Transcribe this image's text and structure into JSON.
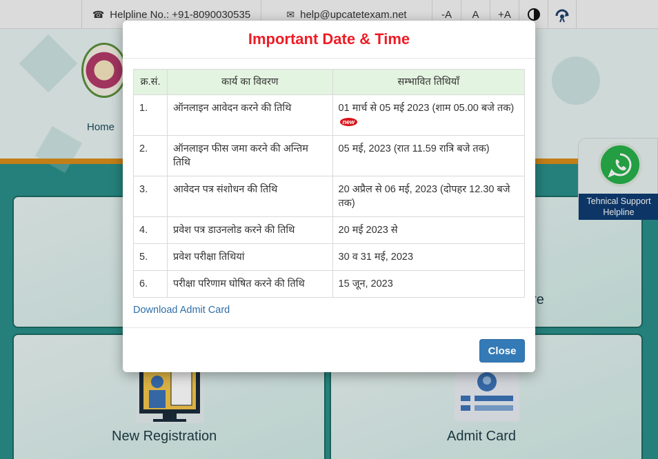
{
  "topbar": {
    "helpline": "Helpline No.: +91-8090030535",
    "email": "help@upcatetexam.net",
    "font_small": "-A",
    "font_normal": "A",
    "font_large": "+A"
  },
  "nav": {
    "home": "Home"
  },
  "cards": {
    "new_registration": "New Registration",
    "admit_card": "Admit Card",
    "partial_right_text": "ure"
  },
  "whatsapp": {
    "label_line1": "Tehnical Support",
    "label_line2": "Helpline"
  },
  "modal": {
    "title": "Important Date & Time",
    "table": {
      "headers": [
        "क्र.सं.",
        "कार्य का विवरण",
        "सम्भावित तिथियाँ"
      ],
      "rows": [
        {
          "sn": "1.",
          "desc": "ऑनलाइन आवेदन करने की तिथि",
          "date": "01 मार्च से 05 मई 2023 (शाम 05.00 बजे तक)",
          "badge": "new"
        },
        {
          "sn": "2.",
          "desc": "ऑनलाइन फीस जमा करने की अन्तिम तिथि",
          "date": "05 मई, 2023 (रात 11.59 रात्रि बजे तक)"
        },
        {
          "sn": "3.",
          "desc": "आवेदन पत्र संशोधन की तिथि",
          "date": "20 अप्रैल से 06 मई, 2023 (दोपहर 12.30 बजे तक)"
        },
        {
          "sn": "4.",
          "desc": "प्रवेश पत्र डाउनलोड करने की तिथि",
          "date": "20 मई 2023 से"
        },
        {
          "sn": "5.",
          "desc": "प्रवेश परीक्षा तिथियां",
          "date": "30 व 31 मई, 2023"
        },
        {
          "sn": "6.",
          "desc": "परीक्षा परिणाम घोषित करने की तिथि",
          "date": "15 जून, 2023"
        }
      ]
    },
    "download_link": "Download Admit Card",
    "close_label": "Close"
  }
}
